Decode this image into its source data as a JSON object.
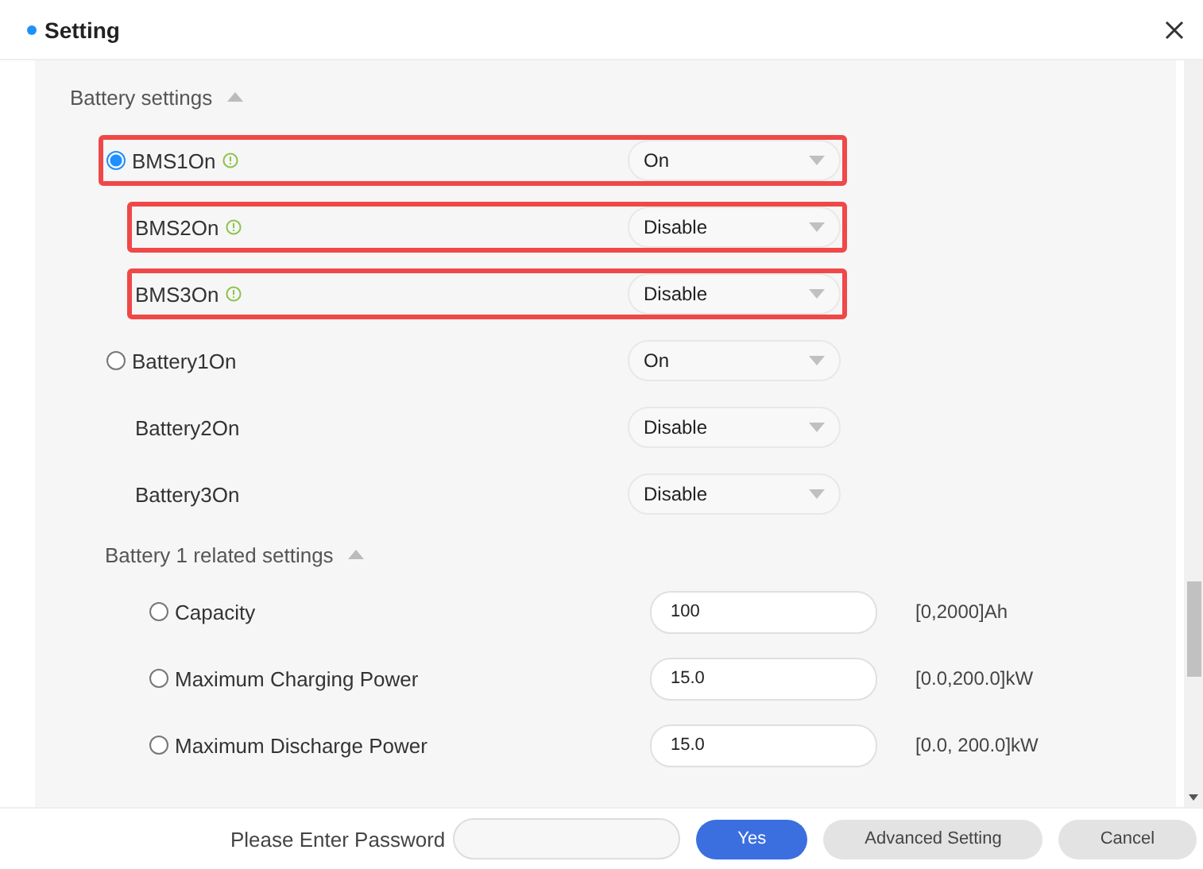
{
  "window": {
    "title": "Setting"
  },
  "sections": [
    {
      "title": "Battery settings",
      "expanded": true,
      "indented": false,
      "rows": [
        {
          "kind": "select",
          "radio": true,
          "label": "BMS1On",
          "info": true,
          "selected": true,
          "highlighted": true,
          "value": "On"
        },
        {
          "kind": "select",
          "radio": false,
          "label": "BMS2On",
          "info": true,
          "highlighted": true,
          "value": "Disable"
        },
        {
          "kind": "select",
          "radio": false,
          "label": "BMS3On",
          "info": true,
          "highlighted": true,
          "value": "Disable"
        },
        {
          "kind": "select",
          "radio": true,
          "label": "Battery1On",
          "info": false,
          "selected": false,
          "highlighted": false,
          "value": "On"
        },
        {
          "kind": "select",
          "radio": false,
          "label": "Battery2On",
          "info": false,
          "highlighted": false,
          "value": "Disable"
        },
        {
          "kind": "select",
          "radio": false,
          "label": "Battery3On",
          "info": false,
          "highlighted": false,
          "value": "Disable"
        }
      ]
    },
    {
      "title": "Battery 1 related settings",
      "expanded": true,
      "indented": true,
      "rows": [
        {
          "kind": "input",
          "radio": true,
          "label": "Capacity",
          "info": false,
          "selected": false,
          "highlighted": false,
          "value": "100",
          "range": "[0,2000]Ah"
        },
        {
          "kind": "input",
          "radio": true,
          "label": "Maximum Charging Power",
          "info": false,
          "selected": false,
          "highlighted": false,
          "value": "15.0",
          "range": "[0.0,200.0]kW"
        },
        {
          "kind": "input",
          "radio": true,
          "label": "Maximum Discharge Power",
          "info": false,
          "selected": false,
          "highlighted": false,
          "value": "15.0",
          "range": "[0.0, 200.0]kW"
        }
      ]
    }
  ],
  "footer": {
    "password_label": "Please Enter Password",
    "buttons": [
      {
        "label": "Yes",
        "kind": "primary"
      },
      {
        "label": "Advanced Setting",
        "kind": "secondary"
      },
      {
        "label": "Cancel",
        "kind": "secondary"
      }
    ]
  }
}
